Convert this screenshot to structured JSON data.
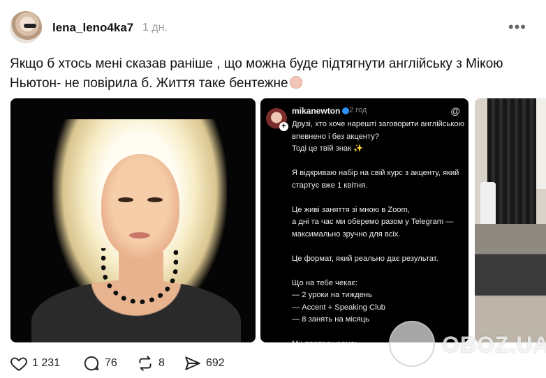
{
  "post": {
    "username": "lena_leno4ka7",
    "time": "1 дн.",
    "more_label": "•••",
    "text": "Якщо б хтось мені сказав раніше , що можна буде підтягнути англійську з Мікою Ньютон- не повірила б. Життя таке бентежне"
  },
  "screenshot": {
    "username": "mikanewton",
    "time": "2 год",
    "text": "Друзі, хто хоче нарешті заговорити англійською впевнено і без акценту?\nТоді це твій знак ✨\n\nЯ відкриваю набір на свій курс з акценту, який стартує вже 1 квітня.\n\nЦе живі заняття зі мною в Zoom,\nа дні та час ми оберемо разом у Telegram — максимально зручно для всіх.\n\nЦе формат, який реально дає результат.\n\nЩо на тебе чекає:\n— 2 уроки на тиждень\n— Accent + Speaking Club\n— 8 занять на місяць\n\nМи пропрацюємо:\n— placement (правильну постановку звуків)\n— мелодику мови\n— приголосні та голосні"
  },
  "watermark": {
    "text": "OBOZ.UA"
  },
  "actions": {
    "likes": "1 231",
    "replies": "76",
    "reposts": "8",
    "shares": "692"
  },
  "colors": {
    "accent_verified": "#2c90f5",
    "muted": "#9a9a9a"
  }
}
